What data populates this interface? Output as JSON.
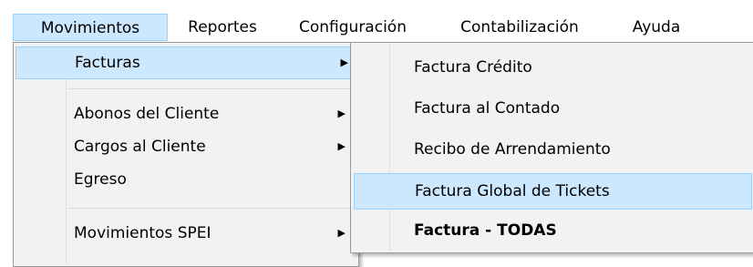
{
  "menubar": {
    "items": [
      {
        "label": "Movimientos"
      },
      {
        "label": "Reportes"
      },
      {
        "label": "Configuración"
      },
      {
        "label": "Contabilización"
      },
      {
        "label": "Ayuda"
      }
    ]
  },
  "movimientos_menu": {
    "items": [
      {
        "label": "Facturas"
      },
      {
        "label": "Abonos del Cliente"
      },
      {
        "label": "Cargos al Cliente"
      },
      {
        "label": "Egreso"
      },
      {
        "label": "Movimientos SPEI"
      }
    ],
    "submenu_arrow": "▶"
  },
  "facturas_submenu": {
    "items": [
      {
        "label": "Factura Crédito"
      },
      {
        "label": "Factura al Contado"
      },
      {
        "label": "Recibo de Arrendamiento"
      },
      {
        "label": "Factura Global de Tickets"
      },
      {
        "label": "Factura - TODAS"
      }
    ]
  },
  "colors": {
    "highlight_fill": "#cce8ff",
    "highlight_border": "#99d1ff",
    "menu_background": "#f2f2f2"
  }
}
